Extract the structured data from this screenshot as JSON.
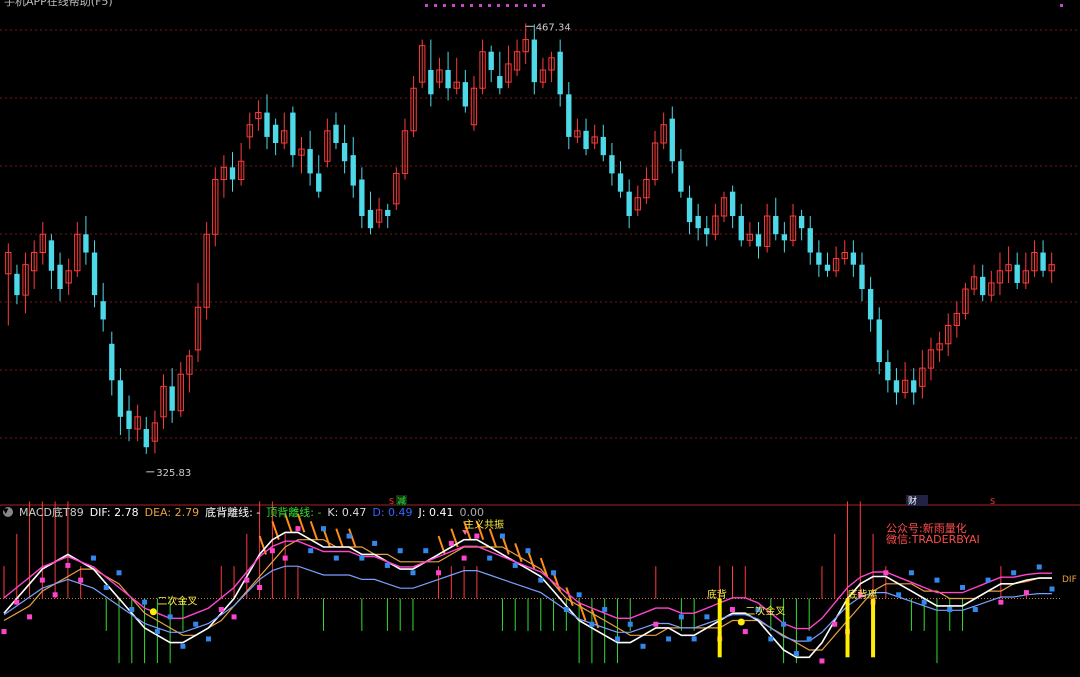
{
  "window": {
    "title_partial": "手机APP在线帮助(F5)"
  },
  "colors": {
    "background": "#000000",
    "up": "#ff3b3b",
    "down": "#4dd9e8",
    "grid": "#7a1a1a",
    "dif": "#ffffff",
    "dea": "#e8a040",
    "k": "#f0f0f0",
    "d": "#3366ff",
    "j": "#ffffff",
    "macd_pos": "#ff3b3b",
    "macd_neg": "#33dd33",
    "divergence_fill": "#ff8c1a",
    "magenta": "#ff44cc",
    "blue_marker": "#3388ee",
    "yellow_label": "#ffee44"
  },
  "indicator_header": {
    "name": "MACD底T89",
    "dif_label": "DIF:",
    "dif_value": "2.78",
    "dea_label": "DEA:",
    "dea_value": "2.79",
    "bottom_div_label": "底背離线: -",
    "top_div_label": "顶背離线: -",
    "k_label": "K:",
    "k_value": "0.47",
    "d_label": "D:",
    "d_value": "0.49",
    "j_label": "J:",
    "j_value": "0.41",
    "extra_value": "0.00"
  },
  "notice": {
    "line1": "公众号:新雨量化",
    "line2": "微信:TRADERBYAI"
  },
  "markers": {
    "high_label": "467.34",
    "low_label": "325.83",
    "divider_tag_left": "减",
    "divider_tag_right": "财",
    "divider_tag_s1": "S",
    "divider_tag_s2": "S",
    "signal_golden_1": "二次金叉",
    "signal_golden_2": "二次金叉",
    "signal_bottom_1": "底背",
    "signal_bottom_2": "底背离",
    "signal_top": "主义共振",
    "dif_right_label": "DIF"
  },
  "chart_data": [
    {
      "type": "candlestick",
      "title": "",
      "ylim": [
        310,
        475
      ],
      "high": 467.34,
      "low": 325.83,
      "grid": true,
      "candles": [
        [
          385,
          392,
          368,
          395
        ],
        [
          385,
          378,
          375,
          388
        ],
        [
          378,
          388,
          372,
          392
        ],
        [
          386,
          392,
          380,
          396
        ],
        [
          392,
          398,
          388,
          402
        ],
        [
          396,
          386,
          380,
          398
        ],
        [
          388,
          380,
          376,
          392
        ],
        [
          382,
          386,
          378,
          390
        ],
        [
          386,
          398,
          384,
          402
        ],
        [
          398,
          392,
          388,
          404
        ],
        [
          392,
          378,
          374,
          396
        ],
        [
          376,
          370,
          366,
          382
        ],
        [
          362,
          350,
          345,
          366
        ],
        [
          350,
          338,
          332,
          354
        ],
        [
          340,
          334,
          330,
          345
        ],
        [
          334,
          338,
          330,
          342
        ],
        [
          334,
          328,
          325.83,
          338
        ],
        [
          330,
          336,
          326,
          340
        ],
        [
          338,
          348,
          334,
          352
        ],
        [
          348,
          340,
          336,
          354
        ],
        [
          340,
          352,
          338,
          356
        ],
        [
          352,
          358,
          346,
          360
        ],
        [
          360,
          374,
          356,
          382
        ],
        [
          374,
          398,
          370,
          402
        ],
        [
          398,
          416,
          394,
          420
        ],
        [
          416,
          420,
          410,
          424
        ],
        [
          420,
          416,
          412,
          425
        ],
        [
          416,
          422,
          414,
          428
        ],
        [
          430,
          434,
          426,
          438
        ],
        [
          436,
          438,
          432,
          442
        ],
        [
          438,
          430,
          426,
          444
        ],
        [
          434,
          428,
          424,
          436
        ],
        [
          428,
          432,
          426,
          438
        ],
        [
          438,
          424,
          420,
          440
        ],
        [
          424,
          426,
          418,
          430
        ],
        [
          426,
          418,
          414,
          432
        ],
        [
          418,
          412,
          410,
          424
        ],
        [
          422,
          432,
          420,
          436
        ],
        [
          434,
          428,
          426,
          438
        ],
        [
          428,
          422,
          418,
          434
        ],
        [
          424,
          414,
          410,
          430
        ],
        [
          416,
          404,
          400,
          420
        ],
        [
          406,
          400,
          398,
          412
        ],
        [
          402,
          406,
          400,
          410
        ],
        [
          406,
          404,
          400,
          408
        ],
        [
          408,
          418,
          406,
          420
        ],
        [
          418,
          432,
          416,
          436
        ],
        [
          432,
          446,
          430,
          450
        ],
        [
          448,
          460,
          446,
          462
        ],
        [
          452,
          444,
          440,
          462
        ],
        [
          448,
          452,
          446,
          456
        ],
        [
          452,
          446,
          442,
          458
        ],
        [
          446,
          448,
          444,
          456
        ],
        [
          448,
          440,
          438,
          452
        ],
        [
          434,
          446,
          432,
          450
        ],
        [
          446,
          458,
          444,
          462
        ],
        [
          458,
          452,
          448,
          460
        ],
        [
          450,
          446,
          444,
          458
        ],
        [
          448,
          454,
          446,
          460
        ],
        [
          452,
          458,
          450,
          462
        ],
        [
          458,
          462,
          454,
          467.34
        ],
        [
          462,
          448,
          444,
          467
        ],
        [
          448,
          452,
          446,
          456
        ],
        [
          452,
          456,
          448,
          458
        ],
        [
          458,
          444,
          440,
          462
        ],
        [
          444,
          430,
          426,
          448
        ],
        [
          430,
          432,
          428,
          436
        ],
        [
          432,
          426,
          424,
          436
        ],
        [
          428,
          430,
          426,
          434
        ],
        [
          430,
          424,
          422,
          434
        ],
        [
          424,
          418,
          414,
          428
        ],
        [
          418,
          412,
          410,
          422
        ],
        [
          412,
          404,
          400,
          416
        ],
        [
          406,
          410,
          404,
          414
        ],
        [
          410,
          416,
          408,
          420
        ],
        [
          416,
          428,
          414,
          432
        ],
        [
          428,
          434,
          426,
          438
        ],
        [
          436,
          422,
          418,
          440
        ],
        [
          422,
          412,
          410,
          426
        ],
        [
          410,
          402,
          398,
          414
        ],
        [
          404,
          400,
          396,
          408
        ],
        [
          400,
          398,
          394,
          404
        ],
        [
          398,
          404,
          396,
          408
        ],
        [
          404,
          410,
          402,
          412
        ],
        [
          412,
          404,
          400,
          414
        ],
        [
          404,
          396,
          394,
          408
        ],
        [
          396,
          398,
          394,
          402
        ],
        [
          398,
          394,
          390,
          402
        ],
        [
          394,
          404,
          392,
          408
        ],
        [
          404,
          398,
          396,
          410
        ],
        [
          398,
          396,
          392,
          402
        ],
        [
          396,
          404,
          394,
          408
        ],
        [
          404,
          400,
          396,
          406
        ],
        [
          400,
          392,
          388,
          404
        ],
        [
          392,
          388,
          384,
          396
        ],
        [
          388,
          386,
          384,
          392
        ],
        [
          386,
          390,
          384,
          394
        ],
        [
          390,
          392,
          388,
          396
        ],
        [
          392,
          388,
          384,
          396
        ],
        [
          388,
          380,
          376,
          392
        ],
        [
          380,
          370,
          366,
          384
        ],
        [
          370,
          356,
          352,
          374
        ],
        [
          356,
          350,
          346,
          360
        ],
        [
          350,
          346,
          342,
          354
        ],
        [
          346,
          350,
          344,
          356
        ],
        [
          350,
          346,
          342,
          354
        ],
        [
          348,
          354,
          344,
          360
        ],
        [
          354,
          360,
          350,
          364
        ],
        [
          360,
          362,
          356,
          366
        ],
        [
          362,
          368,
          358,
          372
        ],
        [
          368,
          372,
          364,
          376
        ],
        [
          372,
          380,
          370,
          382
        ],
        [
          380,
          384,
          378,
          388
        ],
        [
          384,
          378,
          376,
          388
        ],
        [
          378,
          382,
          376,
          386
        ],
        [
          382,
          386,
          378,
          392
        ],
        [
          386,
          388,
          382,
          394
        ],
        [
          388,
          382,
          380,
          392
        ],
        [
          382,
          386,
          380,
          392
        ],
        [
          386,
          392,
          384,
          396
        ],
        [
          392,
          386,
          384,
          396
        ],
        [
          386,
          388,
          382,
          392
        ]
      ]
    },
    {
      "type": "line",
      "title": "",
      "ylim": [
        -10,
        10
      ],
      "series": [
        {
          "name": "DIF",
          "values": [
            -2,
            0,
            2,
            4,
            5,
            6,
            5,
            4,
            2,
            0,
            -2,
            -4,
            -5,
            -6,
            -6,
            -5,
            -4,
            -2,
            0,
            3,
            6,
            8,
            9,
            9,
            8,
            7,
            7,
            7,
            6,
            6,
            5,
            4,
            4,
            5,
            6,
            7,
            8,
            8,
            7,
            6,
            5,
            4,
            3,
            1,
            -1,
            -3,
            -4,
            -5,
            -6,
            -6,
            -5,
            -4,
            -4,
            -5,
            -5,
            -4,
            -3,
            -2,
            -2,
            -3,
            -5,
            -7,
            -8,
            -8,
            -6,
            -3,
            0,
            2,
            3,
            3,
            2,
            1,
            0,
            -1,
            -1,
            -1,
            0,
            1,
            2,
            2,
            2.5,
            2.78,
            2.78
          ]
        },
        {
          "name": "DEA",
          "values": [
            -3,
            -2,
            -1,
            1,
            2,
            3,
            4,
            4,
            3,
            2,
            0,
            -2,
            -3,
            -4,
            -5,
            -5,
            -4,
            -3,
            -1,
            1,
            3,
            5,
            7,
            8,
            8,
            8,
            7,
            7,
            7,
            6,
            6,
            5,
            5,
            5,
            5,
            6,
            7,
            7,
            7,
            7,
            6,
            5,
            4,
            2,
            0,
            -1,
            -2,
            -3,
            -4,
            -5,
            -5,
            -5,
            -4,
            -4,
            -4,
            -4,
            -4,
            -3,
            -3,
            -3,
            -4,
            -5,
            -6,
            -7,
            -7,
            -5,
            -3,
            -1,
            1,
            2,
            2,
            2,
            1,
            1,
            0,
            0,
            0,
            1,
            1,
            2,
            2.3,
            2.79,
            2.79
          ]
        }
      ]
    }
  ]
}
